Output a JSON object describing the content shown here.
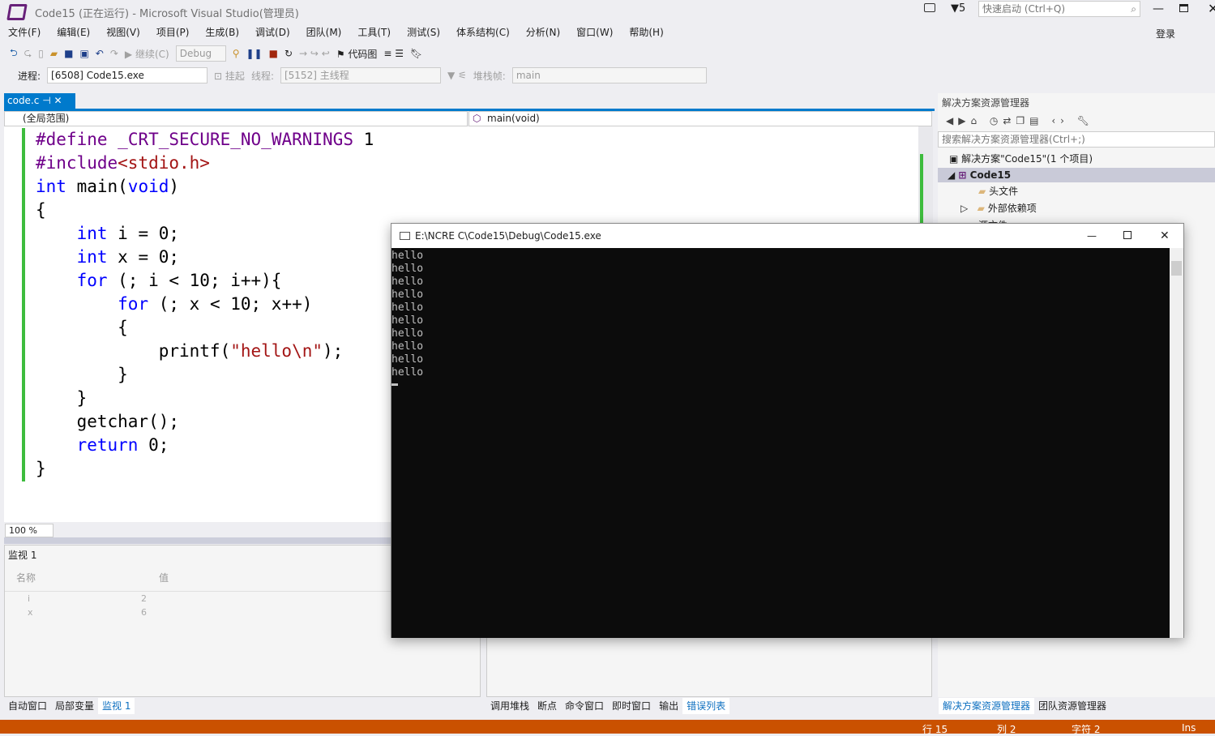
{
  "window": {
    "title": "Code15 (正在运行) - Microsoft Visual Studio(管理员)",
    "notifications": "5",
    "quick_launch_placeholder": "快速启动 (Ctrl+Q)",
    "sign_in": "登录"
  },
  "menu": [
    "文件(F)",
    "编辑(E)",
    "视图(V)",
    "项目(P)",
    "生成(B)",
    "调试(D)",
    "团队(M)",
    "工具(T)",
    "测试(S)",
    "体系结构(C)",
    "分析(N)",
    "窗口(W)",
    "帮助(H)"
  ],
  "toolbar": {
    "continue": "继续(C)",
    "config": "Debug",
    "code_map": "代码图",
    "process_label": "进程:",
    "process": "[6508] Code15.exe",
    "suspend": "挂起",
    "thread_label": "线程:",
    "thread": "[5152] 主线程",
    "stack_label": "堆栈帧:",
    "stack": "main"
  },
  "editor": {
    "tab": "code.c",
    "scope": "(全局范围)",
    "function": "main(void)",
    "zoom": "100 %"
  },
  "console": {
    "title": "E:\\NCRE C\\Code15\\Debug\\Code15.exe",
    "lines": [
      "hello",
      "hello",
      "hello",
      "hello",
      "hello",
      "hello",
      "hello",
      "hello",
      "hello",
      "hello"
    ]
  },
  "solution_explorer": {
    "title": "解决方案资源管理器",
    "search_placeholder": "搜索解决方案资源管理器(Ctrl+;)",
    "solution": "解决方案\"Code15\"(1 个项目)",
    "project": "Code15",
    "items": [
      "头文件",
      "外部依赖项",
      "源文件"
    ]
  },
  "watch": {
    "title": "监视 1",
    "col_name": "名称",
    "col_value": "值",
    "rows": [
      {
        "name": "i",
        "value": "2"
      },
      {
        "name": "x",
        "value": "6"
      }
    ]
  },
  "bottom_tabs_left": [
    "自动窗口",
    "局部变量",
    "监视 1"
  ],
  "bottom_tabs_mid": [
    "调用堆栈",
    "断点",
    "命令窗口",
    "即时窗口",
    "输出",
    "错误列表"
  ],
  "bottom_tabs_right": [
    "解决方案资源管理器",
    "团队资源管理器"
  ],
  "status": {
    "line": "行 15",
    "col": "列 2",
    "char": "字符 2",
    "mode": "Ins"
  },
  "colors": {
    "accent": "#007acc",
    "status_bar": "#ca5100",
    "console_bg": "#0c0c0c"
  }
}
